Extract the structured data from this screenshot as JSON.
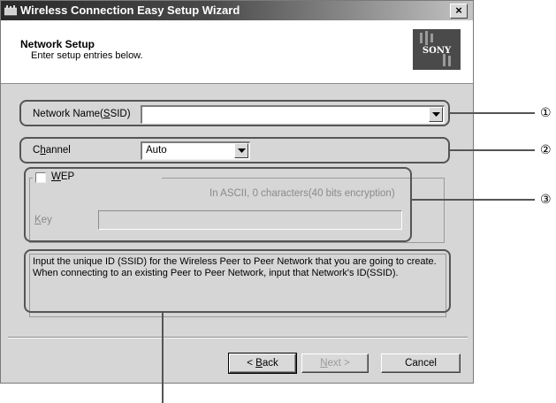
{
  "window": {
    "title": "Wireless Connection Easy Setup Wizard",
    "close_label": "×"
  },
  "header": {
    "title": "Network Setup",
    "subtitle": "Enter setup entries below.",
    "logo_text": "SONY"
  },
  "ssid": {
    "label_pre": "Network Name(",
    "label_mnemonic": "S",
    "label_post": "SID)",
    "value": ""
  },
  "channel": {
    "label_pre": "C",
    "label_mnemonic": "h",
    "label_post": "annel",
    "value": "Auto"
  },
  "wep": {
    "label_mnemonic": "W",
    "label_post": "EP",
    "checked": false,
    "info": "In ASCII, 0 characters(40 bits encryption)",
    "key_mnemonic": "K",
    "key_post": "ey",
    "key_value": ""
  },
  "help": {
    "text": "Input the unique ID (SSID) for the Wireless Peer to Peer Network that you are going to create. When connecting to an existing Peer to Peer Network, input that Network's ID(SSID)."
  },
  "buttons": {
    "back_pre": "< ",
    "back_mnemonic": "B",
    "back_post": "ack",
    "next_mnemonic": "N",
    "next_post": "ext >",
    "cancel": "Cancel"
  },
  "callouts": {
    "one": "①",
    "two": "②",
    "three": "③"
  },
  "colors": {
    "window_face": "#d6d6d6",
    "title_dark": "#2a2a2a",
    "callout_line": "#555555"
  }
}
